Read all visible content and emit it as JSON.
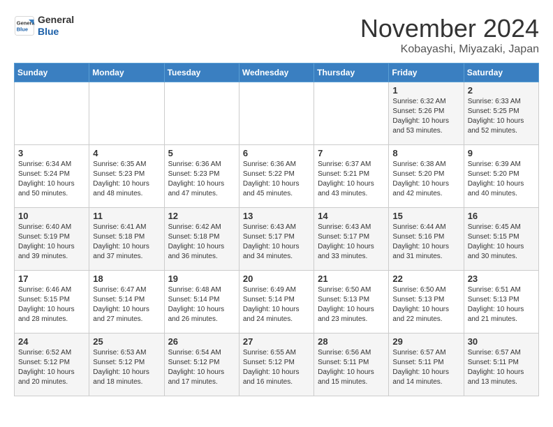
{
  "header": {
    "logo_line1": "General",
    "logo_line2": "Blue",
    "month": "November 2024",
    "location": "Kobayashi, Miyazaki, Japan"
  },
  "weekdays": [
    "Sunday",
    "Monday",
    "Tuesday",
    "Wednesday",
    "Thursday",
    "Friday",
    "Saturday"
  ],
  "weeks": [
    [
      {
        "day": "",
        "info": ""
      },
      {
        "day": "",
        "info": ""
      },
      {
        "day": "",
        "info": ""
      },
      {
        "day": "",
        "info": ""
      },
      {
        "day": "",
        "info": ""
      },
      {
        "day": "1",
        "info": "Sunrise: 6:32 AM\nSunset: 5:26 PM\nDaylight: 10 hours\nand 53 minutes."
      },
      {
        "day": "2",
        "info": "Sunrise: 6:33 AM\nSunset: 5:25 PM\nDaylight: 10 hours\nand 52 minutes."
      }
    ],
    [
      {
        "day": "3",
        "info": "Sunrise: 6:34 AM\nSunset: 5:24 PM\nDaylight: 10 hours\nand 50 minutes."
      },
      {
        "day": "4",
        "info": "Sunrise: 6:35 AM\nSunset: 5:23 PM\nDaylight: 10 hours\nand 48 minutes."
      },
      {
        "day": "5",
        "info": "Sunrise: 6:36 AM\nSunset: 5:23 PM\nDaylight: 10 hours\nand 47 minutes."
      },
      {
        "day": "6",
        "info": "Sunrise: 6:36 AM\nSunset: 5:22 PM\nDaylight: 10 hours\nand 45 minutes."
      },
      {
        "day": "7",
        "info": "Sunrise: 6:37 AM\nSunset: 5:21 PM\nDaylight: 10 hours\nand 43 minutes."
      },
      {
        "day": "8",
        "info": "Sunrise: 6:38 AM\nSunset: 5:20 PM\nDaylight: 10 hours\nand 42 minutes."
      },
      {
        "day": "9",
        "info": "Sunrise: 6:39 AM\nSunset: 5:20 PM\nDaylight: 10 hours\nand 40 minutes."
      }
    ],
    [
      {
        "day": "10",
        "info": "Sunrise: 6:40 AM\nSunset: 5:19 PM\nDaylight: 10 hours\nand 39 minutes."
      },
      {
        "day": "11",
        "info": "Sunrise: 6:41 AM\nSunset: 5:18 PM\nDaylight: 10 hours\nand 37 minutes."
      },
      {
        "day": "12",
        "info": "Sunrise: 6:42 AM\nSunset: 5:18 PM\nDaylight: 10 hours\nand 36 minutes."
      },
      {
        "day": "13",
        "info": "Sunrise: 6:43 AM\nSunset: 5:17 PM\nDaylight: 10 hours\nand 34 minutes."
      },
      {
        "day": "14",
        "info": "Sunrise: 6:43 AM\nSunset: 5:17 PM\nDaylight: 10 hours\nand 33 minutes."
      },
      {
        "day": "15",
        "info": "Sunrise: 6:44 AM\nSunset: 5:16 PM\nDaylight: 10 hours\nand 31 minutes."
      },
      {
        "day": "16",
        "info": "Sunrise: 6:45 AM\nSunset: 5:15 PM\nDaylight: 10 hours\nand 30 minutes."
      }
    ],
    [
      {
        "day": "17",
        "info": "Sunrise: 6:46 AM\nSunset: 5:15 PM\nDaylight: 10 hours\nand 28 minutes."
      },
      {
        "day": "18",
        "info": "Sunrise: 6:47 AM\nSunset: 5:14 PM\nDaylight: 10 hours\nand 27 minutes."
      },
      {
        "day": "19",
        "info": "Sunrise: 6:48 AM\nSunset: 5:14 PM\nDaylight: 10 hours\nand 26 minutes."
      },
      {
        "day": "20",
        "info": "Sunrise: 6:49 AM\nSunset: 5:14 PM\nDaylight: 10 hours\nand 24 minutes."
      },
      {
        "day": "21",
        "info": "Sunrise: 6:50 AM\nSunset: 5:13 PM\nDaylight: 10 hours\nand 23 minutes."
      },
      {
        "day": "22",
        "info": "Sunrise: 6:50 AM\nSunset: 5:13 PM\nDaylight: 10 hours\nand 22 minutes."
      },
      {
        "day": "23",
        "info": "Sunrise: 6:51 AM\nSunset: 5:13 PM\nDaylight: 10 hours\nand 21 minutes."
      }
    ],
    [
      {
        "day": "24",
        "info": "Sunrise: 6:52 AM\nSunset: 5:12 PM\nDaylight: 10 hours\nand 20 minutes."
      },
      {
        "day": "25",
        "info": "Sunrise: 6:53 AM\nSunset: 5:12 PM\nDaylight: 10 hours\nand 18 minutes."
      },
      {
        "day": "26",
        "info": "Sunrise: 6:54 AM\nSunset: 5:12 PM\nDaylight: 10 hours\nand 17 minutes."
      },
      {
        "day": "27",
        "info": "Sunrise: 6:55 AM\nSunset: 5:12 PM\nDaylight: 10 hours\nand 16 minutes."
      },
      {
        "day": "28",
        "info": "Sunrise: 6:56 AM\nSunset: 5:11 PM\nDaylight: 10 hours\nand 15 minutes."
      },
      {
        "day": "29",
        "info": "Sunrise: 6:57 AM\nSunset: 5:11 PM\nDaylight: 10 hours\nand 14 minutes."
      },
      {
        "day": "30",
        "info": "Sunrise: 6:57 AM\nSunset: 5:11 PM\nDaylight: 10 hours\nand 13 minutes."
      }
    ]
  ]
}
